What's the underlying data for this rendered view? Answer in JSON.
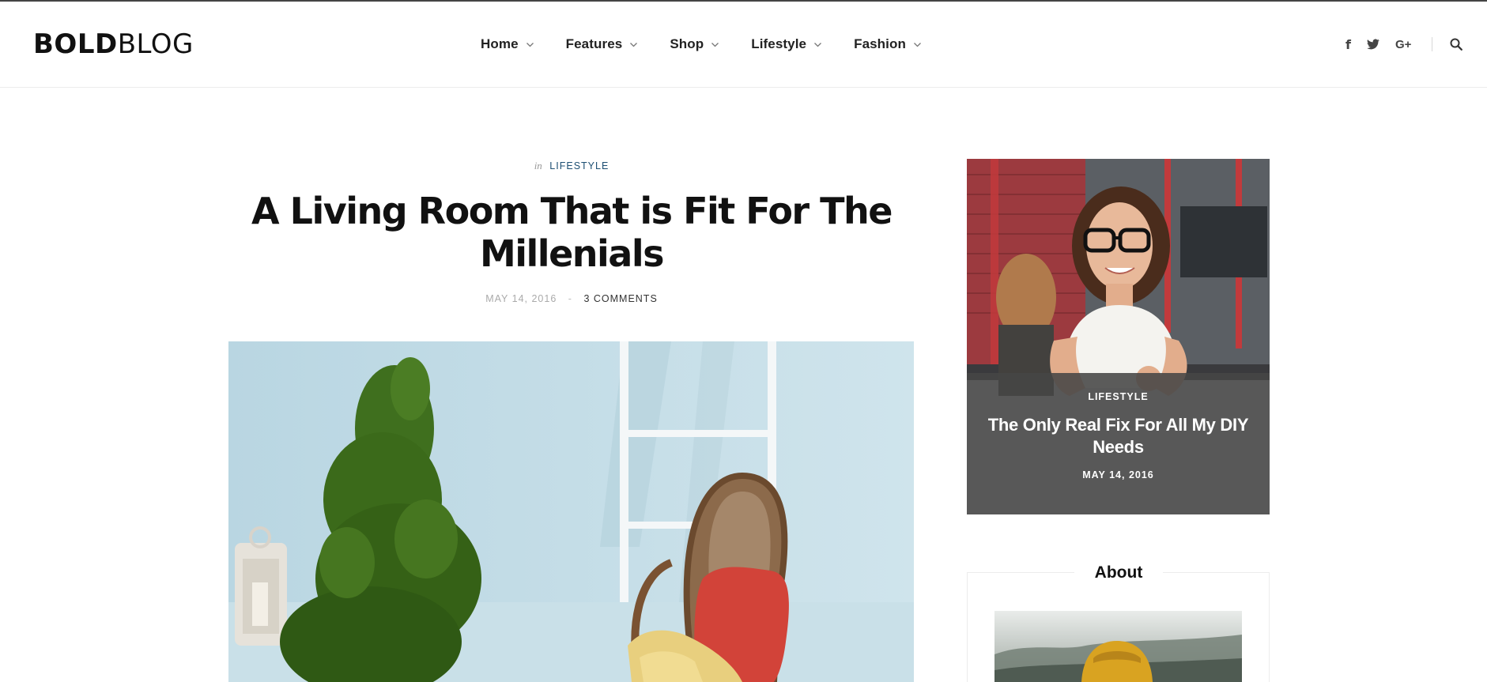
{
  "brand": {
    "logo_bold": "BOLD",
    "logo_light": "BLOG"
  },
  "nav": {
    "items": [
      {
        "label": "Home"
      },
      {
        "label": "Features"
      },
      {
        "label": "Shop"
      },
      {
        "label": "Lifestyle"
      },
      {
        "label": "Fashion"
      }
    ],
    "social": {
      "facebook_glyph": "f",
      "twitter_icon": "twitter-icon",
      "google_glyph": "G+",
      "search_icon": "search-icon"
    }
  },
  "post": {
    "category_prefix": "in",
    "category": "LIFESTYLE",
    "title": "A Living Room That is Fit For The Millenials",
    "date": "MAY 14, 2016",
    "separator": "-",
    "comments": "3 COMMENTS"
  },
  "sidebar": {
    "featured": {
      "category": "LIFESTYLE",
      "title": "The Only Real Fix For All My DIY Needs",
      "date": "MAY 14, 2016"
    },
    "about": {
      "title": "About"
    }
  },
  "colors": {
    "accent": "#1d4f73",
    "text": "#161616",
    "muted": "#aaaaaa",
    "overlay": "#464646"
  }
}
